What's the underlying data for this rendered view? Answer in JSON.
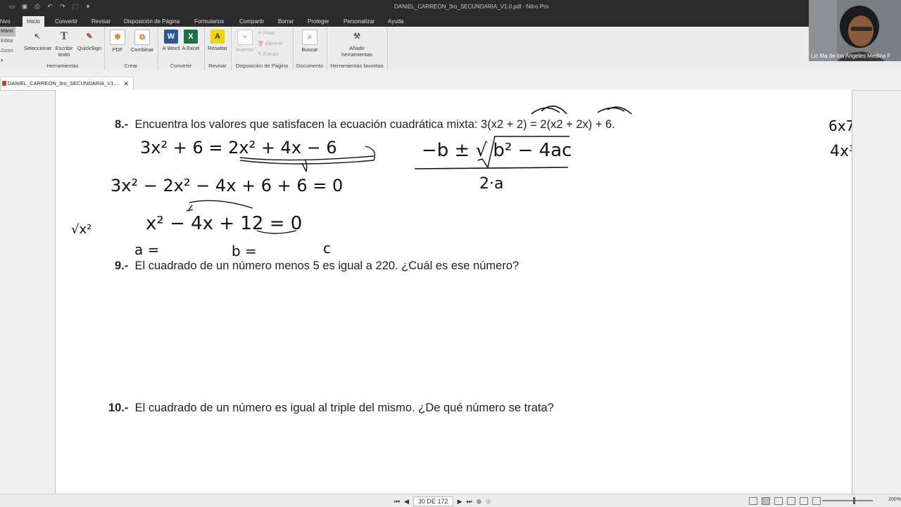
{
  "window": {
    "title": "DANIEL_CARREON_3ro_SECUNDARIA_V1.0.pdf - Nitro Pro"
  },
  "menu_tabs": [
    "hivo",
    "Inicio",
    "Convertir",
    "Revisar",
    "Disposición de Página",
    "Formularios",
    "Compartir",
    "Borrar",
    "Proteger",
    "Personalizar",
    "Ayuda"
  ],
  "left_strip": [
    "Mano",
    "Editar",
    "Zoom ▾"
  ],
  "ribbon": {
    "herramientas": {
      "label": "Herramientas",
      "buttons": [
        "Seleccionar",
        "Escribir texto",
        "QuickSign"
      ]
    },
    "crear": {
      "label": "Crear",
      "buttons": [
        "PDF",
        "Combinar"
      ]
    },
    "convertir": {
      "label": "Convertir",
      "buttons": [
        "A Word",
        "A Excel"
      ]
    },
    "revisar": {
      "label": "Revisar",
      "buttons": [
        "Resaltar"
      ]
    },
    "disposicion": {
      "label": "Disposición de Página",
      "buttons": [
        "Insertar"
      ],
      "small": [
        "Rotar",
        "Eliminar",
        "Extraer"
      ]
    },
    "documento": {
      "label": "Documento",
      "buttons": [
        "Buscar"
      ]
    },
    "favoritas": {
      "label": "Herramientas favoritas",
      "buttons": [
        "Añadir herramientas"
      ]
    }
  },
  "doc_tab": {
    "name": "DANIEL_CARREON_3ro_SECUNDARIA_V1...."
  },
  "questions": [
    {
      "num": "8.-",
      "text": "Encuentra los valores que satisfacen la ecuación cuadrática mixta: 3(x2 + 2) = 2(x2 + 2x) + 6."
    },
    {
      "num": "9.-",
      "text": "El cuadrado de un número menos 5 es igual a 220. ¿Cuál es ese número?"
    },
    {
      "num": "10.-",
      "text": "El cuadrado de un número es igual al triple del mismo. ¿De qué número se trata?"
    }
  ],
  "handwriting": {
    "l1": "3x² + 6 = 2x² + 4x − 6",
    "l2": "3x² − 2x² − 4x + 6 + 6 = 0",
    "l3": "x² − 4x + 12 = 0",
    "l4a": "a =",
    "l4b": "b =",
    "l4c": "c",
    "sqrt": "√x²",
    "formula_num": "−b ± √ b² − 4ac",
    "formula_den": "2·a",
    "side1": "6x7",
    "side2": "4x³"
  },
  "status": {
    "page": "30 DE 172",
    "zoom": "200%"
  },
  "webcam": {
    "caption": "Lic.Ma de los Angeles Medina F"
  }
}
